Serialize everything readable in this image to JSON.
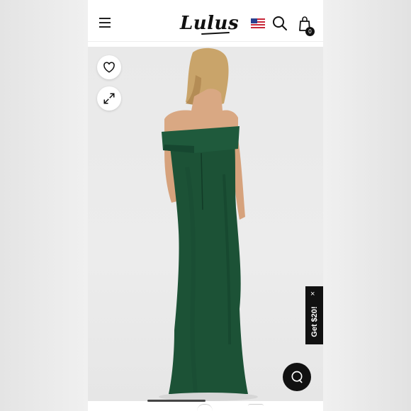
{
  "header": {
    "brand_logo": "Lulus",
    "icons": {
      "menu": "hamburger-menu-icon",
      "flag": "us-flag-icon",
      "search": "search-icon",
      "bag": "shopping-bag-icon"
    },
    "bag_count": "0"
  },
  "product_viewer": {
    "image_description_name": "product-image-green-off-shoulder-gown",
    "dress_color": "#1c5236",
    "actions": {
      "favorite": "heart-icon",
      "expand": "expand-icon"
    }
  },
  "promo": {
    "label": "Get $20!",
    "close": "×"
  },
  "chat": {
    "icon": "chat-bubble-icon"
  }
}
